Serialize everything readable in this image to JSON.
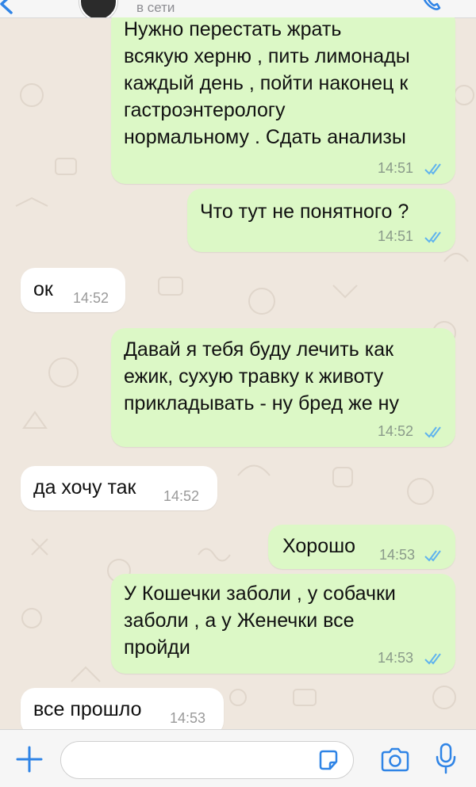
{
  "colors": {
    "outgoing_bubble": "#dcf8c6",
    "incoming_bubble": "#ffffff",
    "accent": "#2f84e6",
    "read_ticks": "#5fb3ee",
    "background": "#efe7de"
  },
  "header": {
    "status": "в сети",
    "back_icon": "chevron-left-icon",
    "call_icon": "phone-icon"
  },
  "messages": [
    {
      "direction": "out",
      "lines": [
        "Нужно перестать жрать",
        "всякую херню , пить лимонады",
        "каждый день , пойти наконец к",
        "гастроэнтерологу",
        "нормальному . Сдать анализы"
      ],
      "time": "14:51",
      "read": true
    },
    {
      "direction": "out",
      "lines": [
        "Что тут не понятного ?"
      ],
      "time": "14:51",
      "read": true
    },
    {
      "direction": "in",
      "lines": [
        "ок"
      ],
      "time": "14:52"
    },
    {
      "direction": "out",
      "lines": [
        "Давай я тебя буду лечить как",
        "ежик, сухую травку к животу",
        "прикладывать - ну бред же ну"
      ],
      "time": "14:52",
      "read": true
    },
    {
      "direction": "in",
      "lines": [
        "да хочу так"
      ],
      "time": "14:52"
    },
    {
      "direction": "out",
      "lines": [
        "Хорошо"
      ],
      "time": "14:53",
      "read": true
    },
    {
      "direction": "out",
      "lines": [
        "У Кошечки заболи , у собачки",
        "заболи , а у Женечки все",
        "пройди"
      ],
      "time": "14:53",
      "read": true
    },
    {
      "direction": "in",
      "lines": [
        "все прошло"
      ],
      "time": "14:53"
    }
  ],
  "input_bar": {
    "placeholder": "",
    "icons": [
      "plus-icon",
      "sticker-icon",
      "camera-icon",
      "microphone-icon"
    ]
  }
}
